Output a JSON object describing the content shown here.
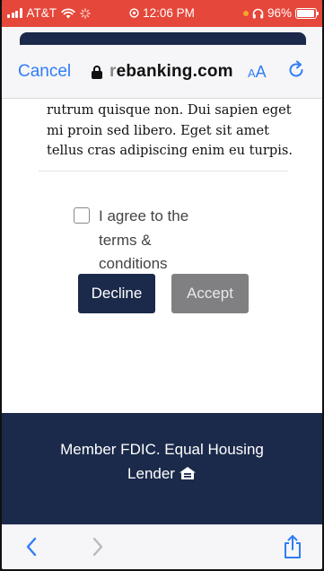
{
  "status_bar": {
    "carrier": "AT&T",
    "time": "12:06 PM",
    "battery": "96%",
    "battery_level": 0.96,
    "icons": [
      "signal-icon",
      "wifi-icon",
      "loading-icon",
      "alarm-icon",
      "headphones-icon",
      "battery-icon"
    ]
  },
  "browser": {
    "cancel_label": "Cancel",
    "url_prefix": "r",
    "url": "ebanking.com",
    "text_size_label_small": "A",
    "text_size_label_large": "A"
  },
  "content": {
    "lorem_lines": [
      "rutrum quisque non. Dui sapien eget",
      "mi proin sed libero. Eget sit amet",
      "tellus cras adipiscing enim eu turpis."
    ],
    "agree_label": "I agree to the terms & conditions",
    "agree_checked": false,
    "decline_label": "Decline",
    "accept_label": "Accept"
  },
  "footer": {
    "line1": "Member FDIC.  Equal Housing",
    "line2": "Lender",
    "icon": "equal-housing-lender-icon"
  },
  "toolbar": {
    "back_icon": "chevron-left-icon",
    "forward_icon": "chevron-right-icon",
    "share_icon": "share-icon"
  },
  "colors": {
    "status_bar": "#e5473a",
    "navy": "#1b2a4a",
    "link_blue": "#2f7df6",
    "accept_gray": "#808083"
  }
}
